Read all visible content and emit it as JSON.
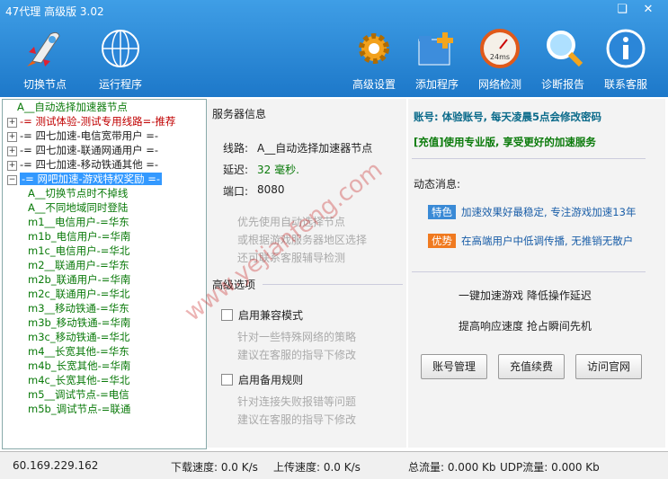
{
  "app": {
    "title": "47代理 高级版 3.02"
  },
  "toolbar": {
    "switch_node": "切换节点",
    "run_program": "运行程序",
    "advanced": "高级设置",
    "add_program": "添加程序",
    "network_check": "网络检测",
    "diagnose": "诊断报告",
    "support": "联系客服",
    "speed_label": "24ms"
  },
  "tree": {
    "items": [
      {
        "label": "A__自动选择加速器节点",
        "color": "#0a7a0a"
      },
      {
        "label": "-= 测试体验-测试专用线路=-推荐",
        "color": "#c00000"
      },
      {
        "label": "-= 四七加速-电信宽带用户 =-",
        "color": "#222"
      },
      {
        "label": "-= 四七加速-联通网通用户 =-",
        "color": "#222"
      },
      {
        "label": "-= 四七加速-移动铁通其他 =-",
        "color": "#222"
      },
      {
        "label": "-= 网吧加速-游戏特权奖励 =-",
        "color": "#ffffff"
      },
      {
        "label": "A__切换节点时不掉线",
        "color": "#0a7a0a"
      },
      {
        "label": "A__不同地域同时登陆",
        "color": "#0a7a0a"
      },
      {
        "label": "m1__电信用户-=华东",
        "color": "#0a7a0a"
      },
      {
        "label": "m1b_电信用户-=华南",
        "color": "#0a7a0a"
      },
      {
        "label": "m1c_电信用户-=华北",
        "color": "#0a7a0a"
      },
      {
        "label": "m2__联通用户-=华东",
        "color": "#0a7a0a"
      },
      {
        "label": "m2b_联通用户-=华南",
        "color": "#0a7a0a"
      },
      {
        "label": "m2c_联通用户-=华北",
        "color": "#0a7a0a"
      },
      {
        "label": "m3__移动铁通-=华东",
        "color": "#0a7a0a"
      },
      {
        "label": "m3b_移动铁通-=华南",
        "color": "#0a7a0a"
      },
      {
        "label": "m3c_移动铁通-=华北",
        "color": "#0a7a0a"
      },
      {
        "label": "m4__长宽其他-=华东",
        "color": "#0a7a0a"
      },
      {
        "label": "m4b_长宽其他-=华南",
        "color": "#0a7a0a"
      },
      {
        "label": "m4c_长宽其他-=华北",
        "color": "#0a7a0a"
      },
      {
        "label": "m5__调试节点-=电信",
        "color": "#0a7a0a"
      },
      {
        "label": "m5b_调试节点-=联通",
        "color": "#0a7a0a"
      }
    ]
  },
  "server": {
    "section": "服务器信息",
    "line_label": "线路:",
    "line_value": "A__自动选择加速器节点",
    "latency_label": "延迟:",
    "latency_value": "32 毫秒.",
    "port_label": "端口:",
    "port_value": "8080",
    "hint1": "优先使用自动选择节点",
    "hint2": "或根据游戏服务器地区选择",
    "hint3": "还可联系客服辅导检测"
  },
  "advanced": {
    "section": "高级选项",
    "compat_label": "启用兼容模式",
    "compat_hint1": "针对一些特殊网络的策略",
    "compat_hint2": "建议在客服的指导下修改",
    "backup_label": "启用备用规则",
    "backup_hint1": "针对连接失败报错等问题",
    "backup_hint2": "建议在客服的指导下修改"
  },
  "account": {
    "line1": "账号: 体验账号, 每天凌晨5点会修改密码",
    "line2": "[充值]使用专业版, 享受更好的加速服务",
    "news_title": "动态消息:",
    "tag1": "特色",
    "news1": "加速效果好最稳定, 专注游戏加速13年",
    "tag2": "优势",
    "news2": "在高端用户中低调传播, 无推销无散户",
    "slogan1": "一键加速游戏  降低操作延迟",
    "slogan2": "提高响应速度  抢占瞬间先机",
    "btn_account": "账号管理",
    "btn_recharge": "充值续费",
    "btn_website": "访问官网"
  },
  "status": {
    "ip": "60.169.229.162",
    "download": "下载速度: 0.0 K/s",
    "upload": "上传速度: 0.0 K/s",
    "total": "总流量: 0.000 Kb",
    "udp": "UDP流量: 0.000 Kb"
  },
  "watermark": "www.yejianfeng.com",
  "colors": {
    "accent": "#1d78c9",
    "tag1": "#3a8ad6",
    "tag2": "#f07a20",
    "green": "#0a7a0a"
  }
}
